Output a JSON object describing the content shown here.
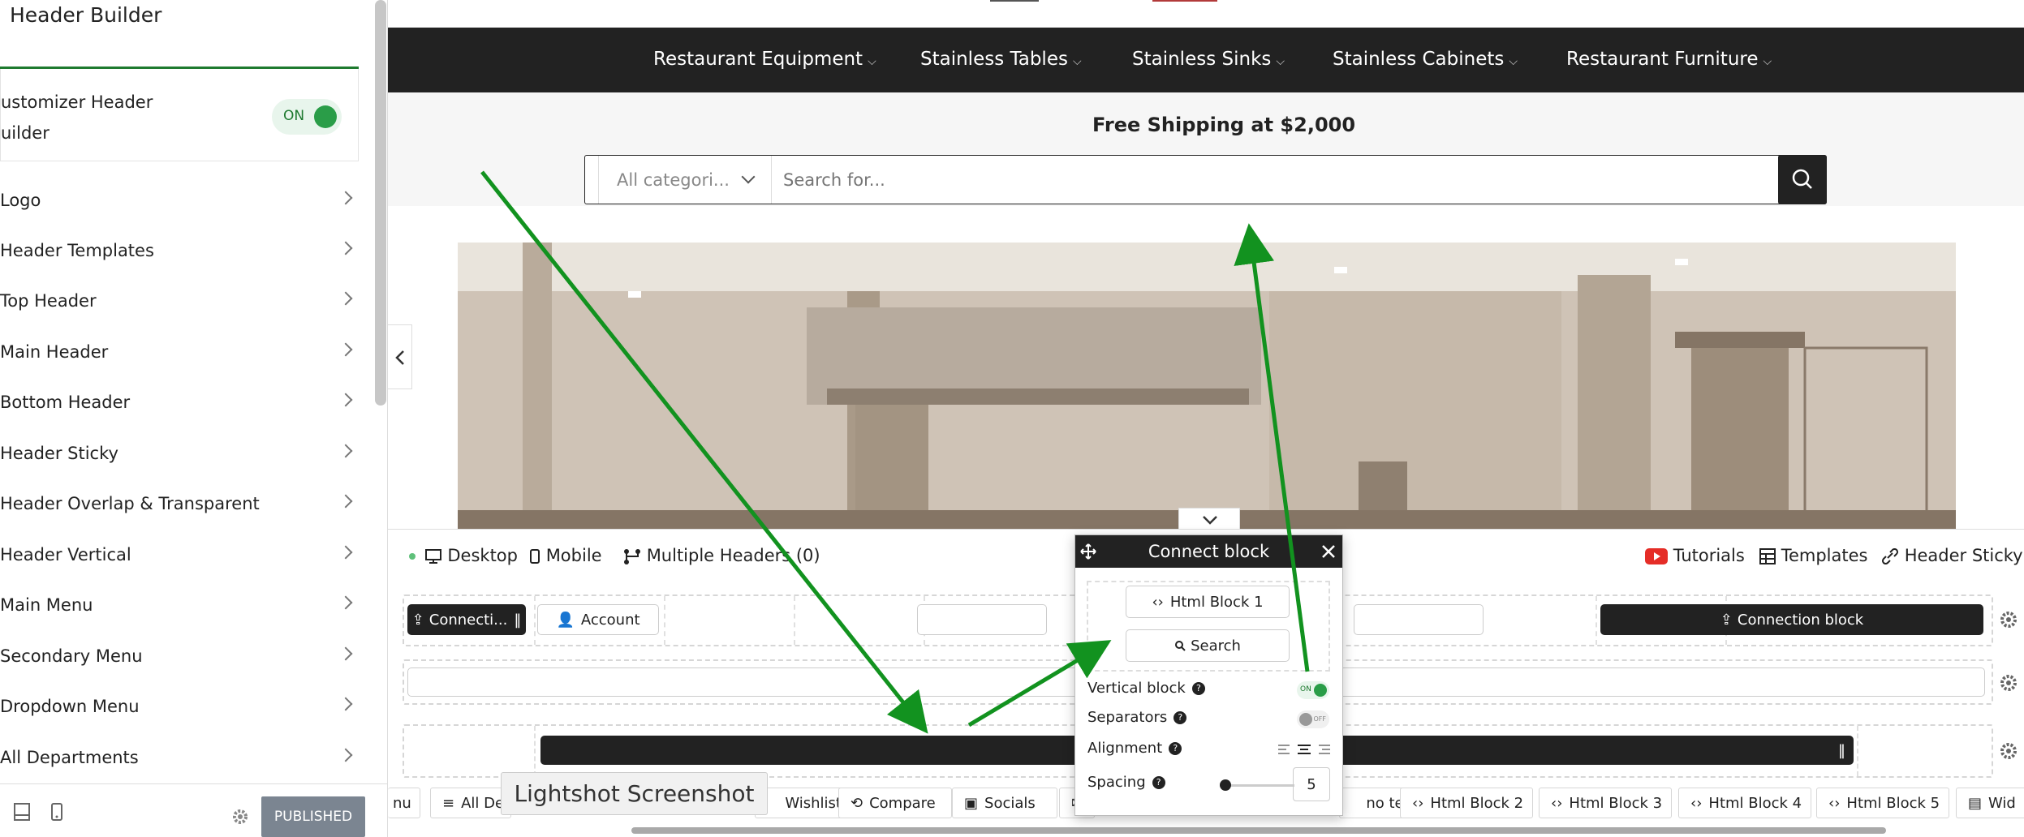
{
  "sidebar": {
    "title": "Header Builder",
    "customizer_label_1": "ustomizer Header",
    "customizer_label_2": "uilder",
    "toggle_label": "ON",
    "items": [
      {
        "label": "Logo"
      },
      {
        "label": "Header Templates"
      },
      {
        "label": "Top Header"
      },
      {
        "label": "Main Header"
      },
      {
        "label": "Bottom Header"
      },
      {
        "label": "Header Sticky"
      },
      {
        "label": "Header Overlap & Transparent"
      },
      {
        "label": "Header Vertical"
      },
      {
        "label": "Main Menu"
      },
      {
        "label": "Secondary Menu"
      },
      {
        "label": "Dropdown Menu"
      },
      {
        "label": "All Departments"
      }
    ],
    "publish_label": "PUBLISHED"
  },
  "site": {
    "nav": [
      {
        "label": "Restaurant Equipment"
      },
      {
        "label": "Stainless Tables"
      },
      {
        "label": "Stainless Sinks"
      },
      {
        "label": "Stainless Cabinets"
      },
      {
        "label": "Restaurant Furniture"
      }
    ],
    "shipping_text": "Free Shipping at $2,000",
    "category_select": "All categori...",
    "search_placeholder": "Search for..."
  },
  "builder": {
    "tabs": {
      "desktop": "Desktop",
      "mobile": "Mobile",
      "multiple": "Multiple Headers (0)",
      "tutorials": "Tutorials",
      "templates": "Templates",
      "sticky": "Header Sticky"
    },
    "row1": {
      "left_block": "Connecti...",
      "account": "Account",
      "right_block": "Connection block"
    },
    "items": [
      {
        "label": "nu"
      },
      {
        "label": "All De"
      },
      {
        "label": "Wishlist"
      },
      {
        "label": "Compare"
      },
      {
        "label": "Socials"
      },
      {
        "label": "no text"
      },
      {
        "label": "Html Block 2"
      },
      {
        "label": "Html Block 3"
      },
      {
        "label": "Html Block 4"
      },
      {
        "label": "Html Block 5"
      },
      {
        "label": "Wid"
      }
    ]
  },
  "popup": {
    "title": "Connect block",
    "block1": "Html Block 1",
    "block2": "Search",
    "vertical_label": "Vertical block",
    "vertical_toggle": "ON",
    "separators_label": "Separators",
    "separators_toggle": "OFF",
    "alignment_label": "Alignment",
    "spacing_label": "Spacing",
    "spacing_value": "5"
  },
  "overlay": {
    "lightshot": "Lightshot Screenshot"
  },
  "colors": {
    "accent": "#1e7a2f",
    "arrow": "#12921f",
    "dark": "#222222",
    "publish": "#7b8591"
  }
}
